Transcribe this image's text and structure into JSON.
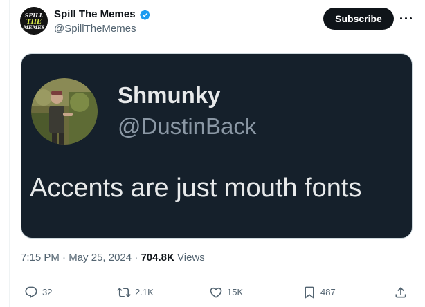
{
  "post": {
    "author_name": "Spill The Memes",
    "author_handle": "@SpillTheMemes",
    "avatar_logo_text": "SPILL THE MEMES",
    "verified": true,
    "subscribe_label": "Subscribe",
    "more_icon": "more-horizontal-icon",
    "time": "7:15 PM",
    "separator": "·",
    "date": "May 25, 2024",
    "views_count": "704.8K",
    "views_label": "Views"
  },
  "media": {
    "name": "Shmunky",
    "handle": "@DustinBack",
    "text": "Accents are just mouth fonts"
  },
  "actions": {
    "reply_count": "32",
    "retweet_count": "2.1K",
    "like_count": "15K",
    "bookmark_count": "487"
  },
  "colors": {
    "accent": "#1d9bf0",
    "subscribe_bg": "#0f1419",
    "card_bg": "#15202b",
    "muted_text": "#536471"
  }
}
